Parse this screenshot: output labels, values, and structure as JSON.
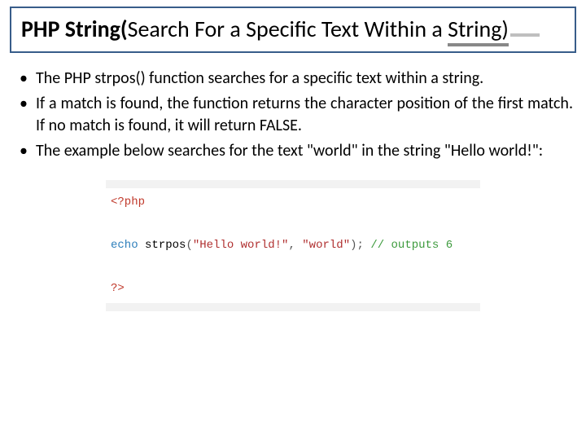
{
  "title": {
    "bold_prefix": "PHP String(",
    "mid": "Search For a Specific Text Within a ",
    "underlined_tail": "String)"
  },
  "bullets": [
    "The PHP strpos() function searches for a specific text within a string.",
    "If a match is found, the function returns the character position of the first match. If no match is found, it will return FALSE.",
    "The example below searches for the text \"world\" in the string \"Hello world!\":"
  ],
  "code": {
    "open_tag": "<?php",
    "kw_echo": "echo",
    "fn": "strpos",
    "paren_open": "(",
    "arg1": "\"Hello world!\"",
    "comma": ", ",
    "arg2": "\"world\"",
    "paren_close": ")",
    "semi": ";",
    "comment": "// outputs 6",
    "close_tag": "?>"
  }
}
